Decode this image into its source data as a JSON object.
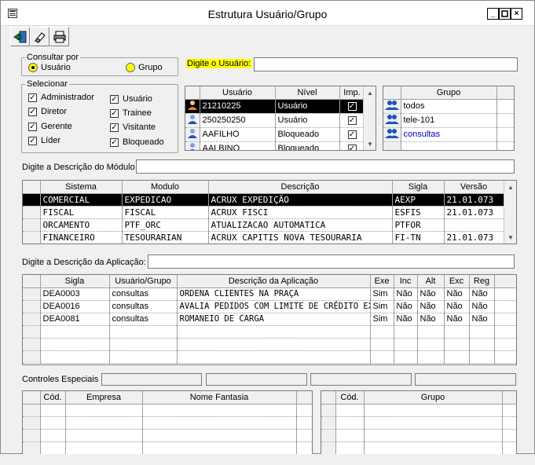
{
  "window": {
    "title": "Estrutura Usuário/Grupo",
    "minimize": "_",
    "maximize": "□",
    "close": "×"
  },
  "toolbar": {
    "icons": [
      "exit-door-icon",
      "eraser-icon",
      "printer-icon"
    ]
  },
  "consultar": {
    "legend": "Consultar por",
    "option_usuario": "Usuário",
    "option_grupo": "Grupo",
    "selected": "Usuário"
  },
  "digite_usuario": {
    "label": "Digite o Usuário:",
    "value": ""
  },
  "selecionar": {
    "legend": "Selecionar",
    "items": [
      {
        "label": "Administrador",
        "checked": true
      },
      {
        "label": "Usuário",
        "checked": true
      },
      {
        "label": "Diretor",
        "checked": true
      },
      {
        "label": "Trainee",
        "checked": true
      },
      {
        "label": "Gerente",
        "checked": true
      },
      {
        "label": "Visitante",
        "checked": true
      },
      {
        "label": "Líder",
        "checked": true
      },
      {
        "label": "Bloqueado",
        "checked": true
      }
    ]
  },
  "users_grid": {
    "headers": [
      "Usuário",
      "Nível",
      "Imp."
    ],
    "rows": [
      {
        "user": "21210225",
        "nivel": "Usuário",
        "imp": true
      },
      {
        "user": "250250250",
        "nivel": "Usuário",
        "imp": true
      },
      {
        "user": "AAFILHO",
        "nivel": "Bloqueado",
        "imp": true
      },
      {
        "user": "AALBINO",
        "nivel": "Bloqueado",
        "imp": true
      }
    ]
  },
  "grupo_grid": {
    "header": "Grupo",
    "rows": [
      "todos",
      "tele-101",
      "consultas",
      ""
    ]
  },
  "modulo": {
    "label": "Digite a Descrição do Módulo",
    "value": "",
    "headers": [
      "Sistema",
      "Modulo",
      "Descrição",
      "Sigla",
      "Versão"
    ],
    "rows": [
      [
        "COMERCIAL",
        "EXPEDICAO",
        "ACRUX EXPEDIÇÃO",
        "AEXP",
        "21.01.073"
      ],
      [
        "FISCAL",
        "FISCAL",
        "ACRUX FISCI",
        "ESFIS",
        "21.01.073"
      ],
      [
        "ORCAMENTO",
        "PTF_ORC",
        "ATUALIZACAO AUTOMATICA",
        "PTFOR",
        ""
      ],
      [
        "FINANCEIRO",
        "TESOURARIAN",
        "ACRUX CAPITIS NOVA TESOURARIA",
        "FI-TN",
        "21.01.073"
      ]
    ]
  },
  "aplicacao": {
    "label": "Digite a Descrição da Aplicação:",
    "value": "",
    "headers": [
      "Sigla",
      "Usuário/Grupo",
      "Descrição da Aplicação",
      "Exe",
      "Inc",
      "Alt",
      "Exc",
      "Reg"
    ],
    "rows": [
      [
        "DEA0003",
        "consultas",
        "ORDENA CLIENTES NA PRAÇA",
        "Sim",
        "Não",
        "Não",
        "Não",
        "Não"
      ],
      [
        "DEA0016",
        "consultas",
        "AVALIA PEDIDOS COM LIMITE DE CRÉDITO EX(",
        "Sim",
        "Não",
        "Não",
        "Não",
        "Não"
      ],
      [
        "DEA0081",
        "consultas",
        "ROMANEIO DE CARGA",
        "Sim",
        "Não",
        "Não",
        "Não",
        "Não"
      ]
    ]
  },
  "controles": {
    "label": "Controles Especiais"
  },
  "empresa_grid": {
    "headers": [
      "Cód.",
      "Empresa",
      "Nome Fantasia"
    ]
  },
  "grupo2_grid": {
    "headers": [
      "Cód.",
      "Grupo"
    ]
  },
  "colors": {
    "highlight": "#ffff00",
    "selected_row": "#000000",
    "link_blue": "#0000cc"
  }
}
